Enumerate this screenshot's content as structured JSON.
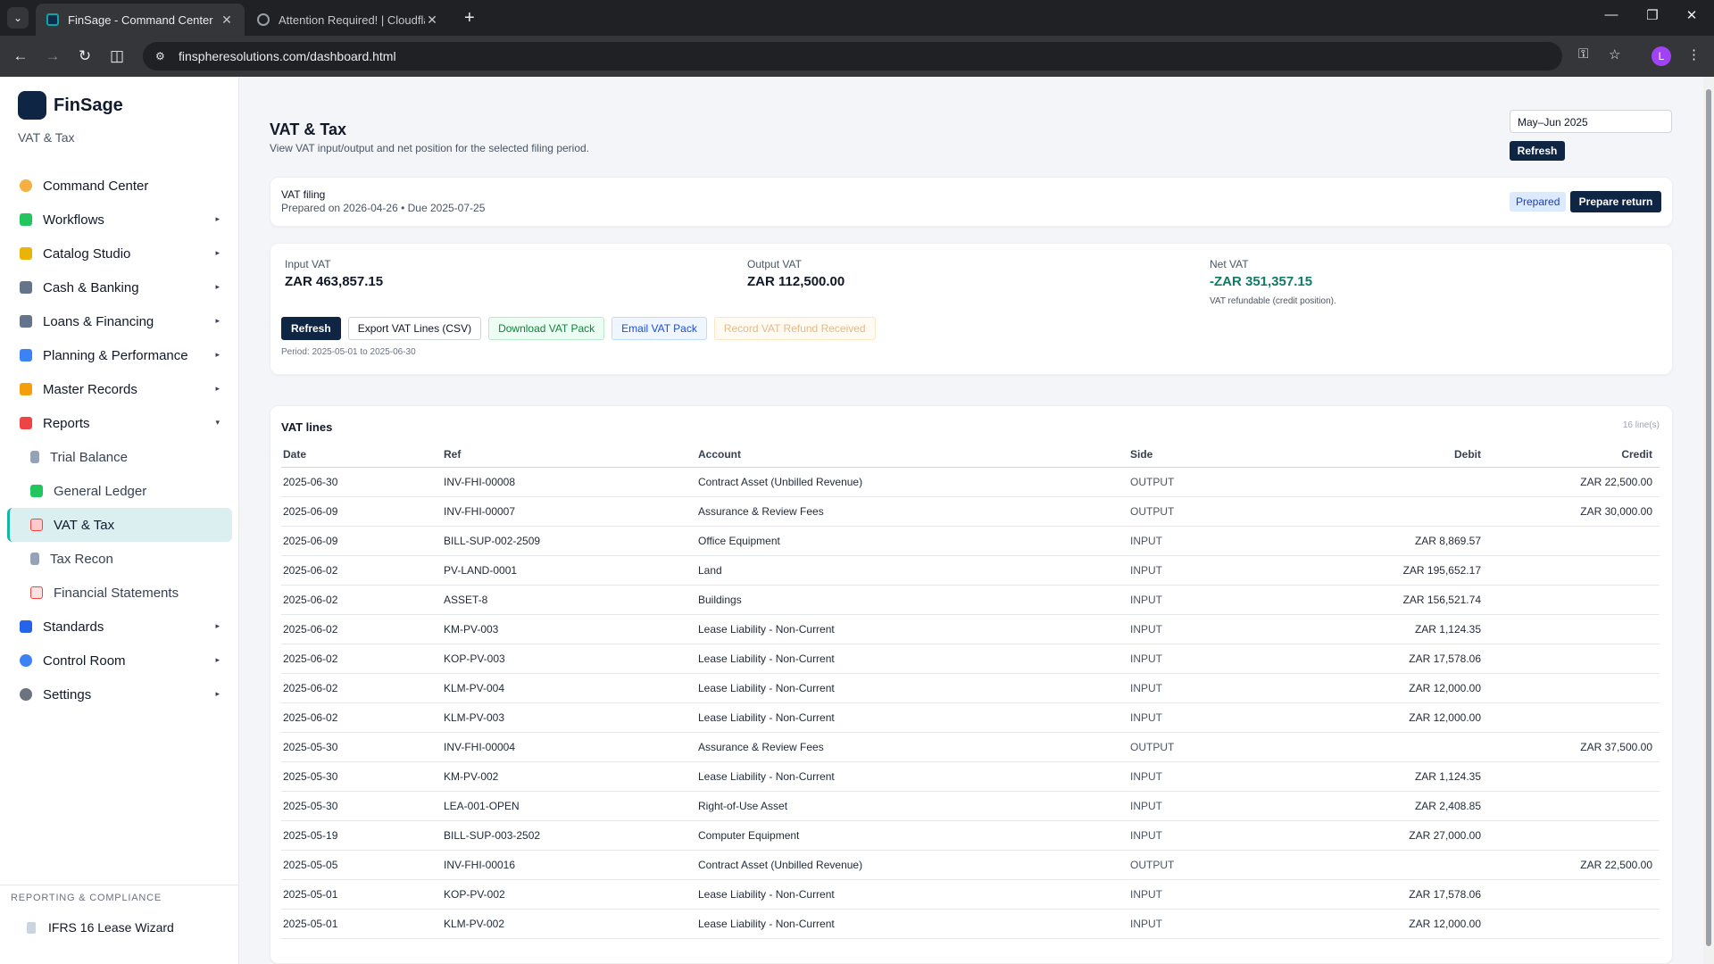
{
  "browser": {
    "tabs": [
      {
        "title": "FinSage - Command Center",
        "active": true
      },
      {
        "title": "Attention Required! | Cloudflare",
        "active": false
      }
    ],
    "url": "finspheresolutions.com/dashboard.html",
    "profile_initial": "L"
  },
  "sidebar": {
    "brand": "FinSage",
    "subtitle": "VAT & Tax",
    "items": [
      {
        "label": "Command Center",
        "icon": "target-icon",
        "color": "#f5b041"
      },
      {
        "label": "Workflows",
        "icon": "puzzle-icon",
        "color": "#22c55e",
        "caret": "▸"
      },
      {
        "label": "Catalog Studio",
        "icon": "tag-icon",
        "color": "#eab308",
        "caret": "▸"
      },
      {
        "label": "Cash & Banking",
        "icon": "bank-icon",
        "color": "#64748b",
        "caret": "▸"
      },
      {
        "label": "Loans & Financing",
        "icon": "bank-icon",
        "color": "#64748b",
        "caret": "▸"
      },
      {
        "label": "Planning & Performance",
        "icon": "bar-chart-icon",
        "color": "#3b82f6",
        "caret": "▸"
      },
      {
        "label": "Master Records",
        "icon": "folder-icon",
        "color": "#f59e0b",
        "caret": "▸"
      },
      {
        "label": "Reports",
        "icon": "bar-chart-icon",
        "color": "#ef4444",
        "caret": "▾"
      }
    ],
    "report_items": [
      {
        "label": "Trial Balance",
        "icon": "ledger-icon",
        "color": "#94a3b8"
      },
      {
        "label": "General Ledger",
        "icon": "books-icon",
        "color": "#22c55e"
      },
      {
        "label": "VAT & Tax",
        "icon": "receipt-icon",
        "color": "#ef4444",
        "active": true
      },
      {
        "label": "Tax Recon",
        "icon": "ledger-icon",
        "color": "#94a3b8"
      },
      {
        "label": "Financial Statements",
        "icon": "trend-icon",
        "color": "#ef4444"
      }
    ],
    "items_after": [
      {
        "label": "Standards",
        "icon": "book-icon",
        "color": "#2563eb",
        "caret": "▸"
      },
      {
        "label": "Control Room",
        "icon": "shield-icon",
        "color": "#3b82f6",
        "caret": "▸"
      },
      {
        "label": "Settings",
        "icon": "gear-icon",
        "color": "#6b7280",
        "caret": "▸"
      }
    ],
    "section_heading": "REPORTING & COMPLIANCE",
    "section_item": "IFRS 16 Lease Wizard"
  },
  "page": {
    "title": "VAT & Tax",
    "subtitle": "View VAT input/output and net position for the selected filing period.",
    "period_value": "May–Jun 2025",
    "refresh_label": "Refresh"
  },
  "filing": {
    "title": "VAT filing",
    "meta": "Prepared on 2026-04-26 • Due 2025-07-25",
    "status": "Prepared",
    "action": "Prepare return"
  },
  "summary": {
    "input_label": "Input VAT",
    "input_value": "ZAR 463,857.15",
    "output_label": "Output VAT",
    "output_value": "ZAR 112,500.00",
    "net_label": "Net VAT",
    "net_value": "-ZAR 351,357.15",
    "net_note": "VAT refundable (credit position).",
    "actions": [
      "Refresh",
      "Export VAT Lines (CSV)",
      "Download VAT Pack",
      "Email VAT Pack",
      "Record VAT Refund Received"
    ],
    "period_note": "Period: 2025-05-01 to 2025-06-30"
  },
  "vat_lines": {
    "title": "VAT lines",
    "count": "16 line(s)",
    "columns": [
      "Date",
      "Ref",
      "Account",
      "Side",
      "Debit",
      "Credit"
    ],
    "rows": [
      [
        "2025-06-30",
        "INV-FHI-00008",
        "Contract Asset (Unbilled Revenue)",
        "OUTPUT",
        "",
        "ZAR 22,500.00"
      ],
      [
        "2025-06-09",
        "INV-FHI-00007",
        "Assurance & Review Fees",
        "OUTPUT",
        "",
        "ZAR 30,000.00"
      ],
      [
        "2025-06-09",
        "BILL-SUP-002-2509",
        "Office Equipment",
        "INPUT",
        "ZAR 8,869.57",
        ""
      ],
      [
        "2025-06-02",
        "PV-LAND-0001",
        "Land",
        "INPUT",
        "ZAR 195,652.17",
        ""
      ],
      [
        "2025-06-02",
        "ASSET-8",
        "Buildings",
        "INPUT",
        "ZAR 156,521.74",
        ""
      ],
      [
        "2025-06-02",
        "KM-PV-003",
        "Lease Liability - Non-Current",
        "INPUT",
        "ZAR 1,124.35",
        ""
      ],
      [
        "2025-06-02",
        "KOP-PV-003",
        "Lease Liability - Non-Current",
        "INPUT",
        "ZAR 17,578.06",
        ""
      ],
      [
        "2025-06-02",
        "KLM-PV-004",
        "Lease Liability - Non-Current",
        "INPUT",
        "ZAR 12,000.00",
        ""
      ],
      [
        "2025-06-02",
        "KLM-PV-003",
        "Lease Liability - Non-Current",
        "INPUT",
        "ZAR 12,000.00",
        ""
      ],
      [
        "2025-05-30",
        "INV-FHI-00004",
        "Assurance & Review Fees",
        "OUTPUT",
        "",
        "ZAR 37,500.00"
      ],
      [
        "2025-05-30",
        "KM-PV-002",
        "Lease Liability - Non-Current",
        "INPUT",
        "ZAR 1,124.35",
        ""
      ],
      [
        "2025-05-30",
        "LEA-001-OPEN",
        "Right-of-Use Asset",
        "INPUT",
        "ZAR 2,408.85",
        ""
      ],
      [
        "2025-05-19",
        "BILL-SUP-003-2502",
        "Computer Equipment",
        "INPUT",
        "ZAR 27,000.00",
        ""
      ],
      [
        "2025-05-05",
        "INV-FHI-00016",
        "Contract Asset (Unbilled Revenue)",
        "OUTPUT",
        "",
        "ZAR 22,500.00"
      ],
      [
        "2025-05-01",
        "KOP-PV-002",
        "Lease Liability - Non-Current",
        "INPUT",
        "ZAR 17,578.06",
        ""
      ],
      [
        "2025-05-01",
        "KLM-PV-002",
        "Lease Liability - Non-Current",
        "INPUT",
        "ZAR 12,000.00",
        ""
      ]
    ]
  }
}
